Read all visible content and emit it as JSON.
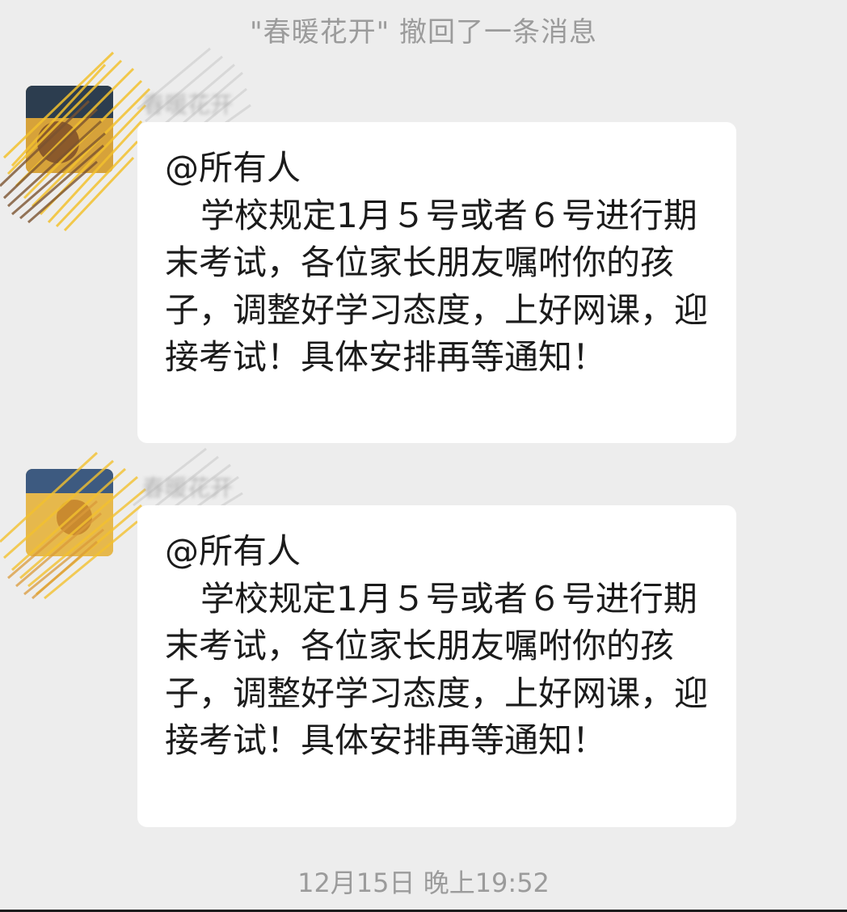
{
  "recall_notice": "\"春暖花开\" 撤回了一条消息",
  "messages": [
    {
      "sender": "春暖花开",
      "mention": "@所有人",
      "text": "学校规定1月５号或者６号进行期末考试，各位家长朋友嘱咐你的孩子，调整好学习态度，上好网课，迎接考试！具体安排再等通知！"
    },
    {
      "sender": "春暖花开",
      "mention": "@所有人",
      "text": "学校规定1月５号或者６号进行期末考试，各位家长朋友嘱咐你的孩子，调整好学习态度，上好网课，迎接考试！具体安排再等通知！"
    }
  ],
  "timestamp": "12月15日 晚上19:52",
  "colors": {
    "background": "#ededed",
    "bubble": "#ffffff",
    "system_text": "#9b9b9b",
    "message_text": "#1b1b1b",
    "scribble_yellow": "#f2c12e",
    "scribble_brown": "#7a5230"
  }
}
